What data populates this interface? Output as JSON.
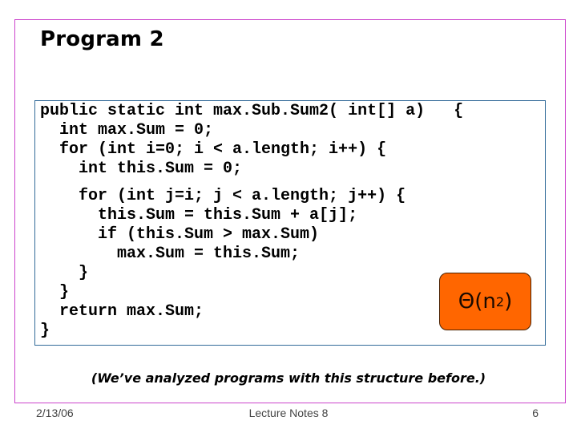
{
  "slide": {
    "title": "Program 2",
    "code_lines": [
      "public static int max.Sub.Sum2( int[] a)   {",
      "  int max.Sum = 0;",
      "  for (int i=0; i < a.length; i++) {",
      "    int this.Sum = 0;",
      "",
      "    for (int j=i; j < a.length; j++) {",
      "      this.Sum = this.Sum + a[j];",
      "      if (this.Sum > max.Sum)",
      "        max.Sum = this.Sum;",
      "    }",
      "  }",
      "  return max.Sum;",
      "}"
    ],
    "complexity": {
      "prefix": "Θ(n",
      "exponent": "2",
      "suffix": ")"
    },
    "note": "(We’ve analyzed programs with this structure before.)"
  },
  "footer": {
    "date": "2/13/06",
    "center": "Lecture Notes 8",
    "page": "6"
  },
  "colors": {
    "frame": "#cc44cc",
    "code_border": "#336b99",
    "badge_fill": "#ff6600"
  }
}
